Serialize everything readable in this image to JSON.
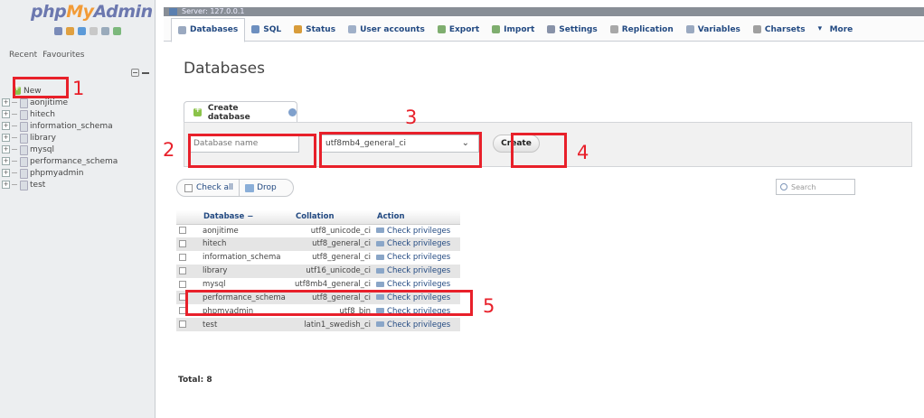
{
  "sidebar": {
    "logo": {
      "php": "php",
      "my": "My",
      "admin": "Admin"
    },
    "quick_icon_colors": [
      "#7a8bb8",
      "#e0a040",
      "#5c9ad8",
      "#c8c8c8",
      "#9ab",
      "#7cb87c"
    ],
    "recent_label": "Recent",
    "favourites_label": "Favourites",
    "new_label": "New",
    "databases": [
      "aonjitime",
      "hitech",
      "information_schema",
      "library",
      "mysql",
      "performance_schema",
      "phpmyadmin",
      "test"
    ]
  },
  "server_bar": {
    "label": "Server: 127.0.0.1"
  },
  "menu": {
    "tabs": [
      {
        "key": "databases",
        "label": "Databases",
        "icon": "database-icon",
        "color": "#9aa9c0"
      },
      {
        "key": "sql",
        "label": "SQL",
        "icon": "sql-icon",
        "color": "#6d8fbf"
      },
      {
        "key": "status",
        "label": "Status",
        "icon": "status-icon",
        "color": "#d89c3a"
      },
      {
        "key": "user-accounts",
        "label": "User accounts",
        "icon": "users-icon",
        "color": "#a0b0c8"
      },
      {
        "key": "export",
        "label": "Export",
        "icon": "export-icon",
        "color": "#7fae6f"
      },
      {
        "key": "import",
        "label": "Import",
        "icon": "import-icon",
        "color": "#7fae6f"
      },
      {
        "key": "settings",
        "label": "Settings",
        "icon": "wrench-icon",
        "color": "#8892a8"
      },
      {
        "key": "replication",
        "label": "Replication",
        "icon": "replication-icon",
        "color": "#a8a8a8"
      },
      {
        "key": "variables",
        "label": "Variables",
        "icon": "variables-icon",
        "color": "#9aa9c0"
      },
      {
        "key": "charsets",
        "label": "Charsets",
        "icon": "charsets-icon",
        "color": "#a0a0a0"
      },
      {
        "key": "more",
        "label": "More",
        "icon": "caret-down-icon",
        "color": "#234a82"
      }
    ]
  },
  "main": {
    "title": "Databases",
    "create_tab_label": "Create database",
    "dbname_placeholder": "Database name",
    "collation_selected": "utf8mb4_general_ci",
    "create_button_label": "Create",
    "check_all_label": "Check all",
    "drop_label": "Drop",
    "search_placeholder": "Search",
    "table": {
      "headers": {
        "database": "Database",
        "collation": "Collation",
        "action": "Action"
      },
      "sort_indicator": "−",
      "check_privileges_label": "Check privileges",
      "rows": [
        {
          "name": "aonjitime",
          "collation": "utf8_unicode_ci"
        },
        {
          "name": "hitech",
          "collation": "utf8_general_ci"
        },
        {
          "name": "information_schema",
          "collation": "utf8_general_ci"
        },
        {
          "name": "library",
          "collation": "utf16_unicode_ci"
        },
        {
          "name": "mysql",
          "collation": "utf8mb4_general_ci"
        },
        {
          "name": "performance_schema",
          "collation": "utf8_general_ci"
        },
        {
          "name": "phpmyadmin",
          "collation": "utf8_bin"
        },
        {
          "name": "test",
          "collation": "latin1_swedish_ci"
        }
      ]
    },
    "total_label": "Total: 8"
  },
  "annotations": {
    "color": "#e8202a",
    "labels": [
      "1",
      "2",
      "3",
      "4",
      "5"
    ]
  }
}
